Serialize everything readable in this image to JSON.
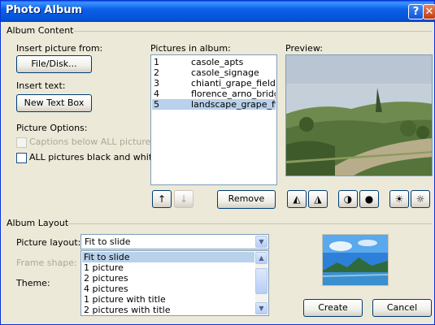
{
  "window": {
    "title": "Photo Album"
  },
  "album_content": {
    "section_label": "Album Content",
    "insert_picture_label": "Insert picture from:",
    "file_disk_button": "File/Disk...",
    "insert_text_label": "Insert text:",
    "new_text_box_button": "New Text Box",
    "picture_options_label": "Picture Options:",
    "captions_option": "Captions below ALL pictures",
    "black_white_option": "ALL pictures black and white",
    "pictures_label": "Pictures in album:",
    "pictures": [
      {
        "num": "1",
        "name": "casole_apts"
      },
      {
        "num": "2",
        "name": "casole_signage"
      },
      {
        "num": "3",
        "name": "chianti_grape_fields_i"
      },
      {
        "num": "4",
        "name": "florence_arno_bridge"
      },
      {
        "num": "5",
        "name": "landscape_grape_fiel"
      }
    ],
    "selected_index": 5,
    "move_up_glyph": "↑",
    "move_down_glyph": "↓",
    "remove_button": "Remove",
    "preview_label": "Preview:",
    "image_tools": [
      {
        "icon": "rotate-left-icon",
        "glyph": "◭"
      },
      {
        "icon": "rotate-right-icon",
        "glyph": "◮"
      },
      {
        "icon": "contrast-increase-icon",
        "glyph": "◑"
      },
      {
        "icon": "contrast-decrease-icon",
        "glyph": "●"
      },
      {
        "icon": "brightness-increase-icon",
        "glyph": "☀"
      },
      {
        "icon": "brightness-decrease-icon",
        "glyph": "☼"
      }
    ]
  },
  "album_layout": {
    "section_label": "Album Layout",
    "picture_layout_label": "Picture layout:",
    "picture_layout_value": "Fit to slide",
    "frame_shape_label": "Frame shape:",
    "theme_label": "Theme:",
    "layout_options": [
      "Fit to slide",
      "1 picture",
      "2 pictures",
      "4 pictures",
      "1 picture with title",
      "2 pictures with title"
    ],
    "highlighted_option": "Fit to slide"
  },
  "actions": {
    "create": "Create",
    "cancel": "Cancel"
  },
  "colors": {
    "titlebar": "#0552d6",
    "face": "#ece9d8",
    "selection": "#b9d1ea",
    "list_border": "#7f9db9"
  }
}
